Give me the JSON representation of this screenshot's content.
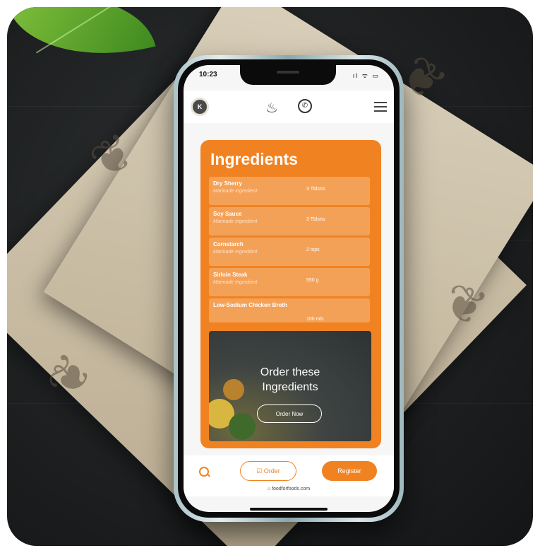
{
  "status_bar": {
    "time": "10:23",
    "icons": "ıl ᯤ ▭"
  },
  "header": {
    "avatar_initials": "K",
    "logo_icon": "chef-hat-icon",
    "whatsapp_icon": "whatsapp-icon",
    "menu_icon": "hamburger-icon"
  },
  "ingredients": {
    "title": "Ingredients",
    "items": [
      {
        "name": "Dry Sherry",
        "category": "Marinade Ingredient",
        "quantity": "3 Tblsns"
      },
      {
        "name": "Soy Sauce",
        "category": "Marinade Ingredient",
        "quantity": "3 Tblsns"
      },
      {
        "name": "Cornstarch",
        "category": "Marinade Ingredient",
        "quantity": "2 tsps"
      },
      {
        "name": "Sirloin Steak",
        "category": "Marinade Ingredient",
        "quantity": "550 g"
      },
      {
        "name": "Low-Sodium Chicken Broth",
        "category": "",
        "quantity": "100 mls"
      }
    ]
  },
  "order_promo": {
    "title_line1": "Order these",
    "title_line2": "Ingredients",
    "button_label": "Order Now"
  },
  "bottom_bar": {
    "order_label": "☑ Order",
    "register_label": "Register",
    "url": "⌂ foodforfoods.com"
  },
  "colors": {
    "accent": "#f18221",
    "background": "#1d1f20"
  }
}
